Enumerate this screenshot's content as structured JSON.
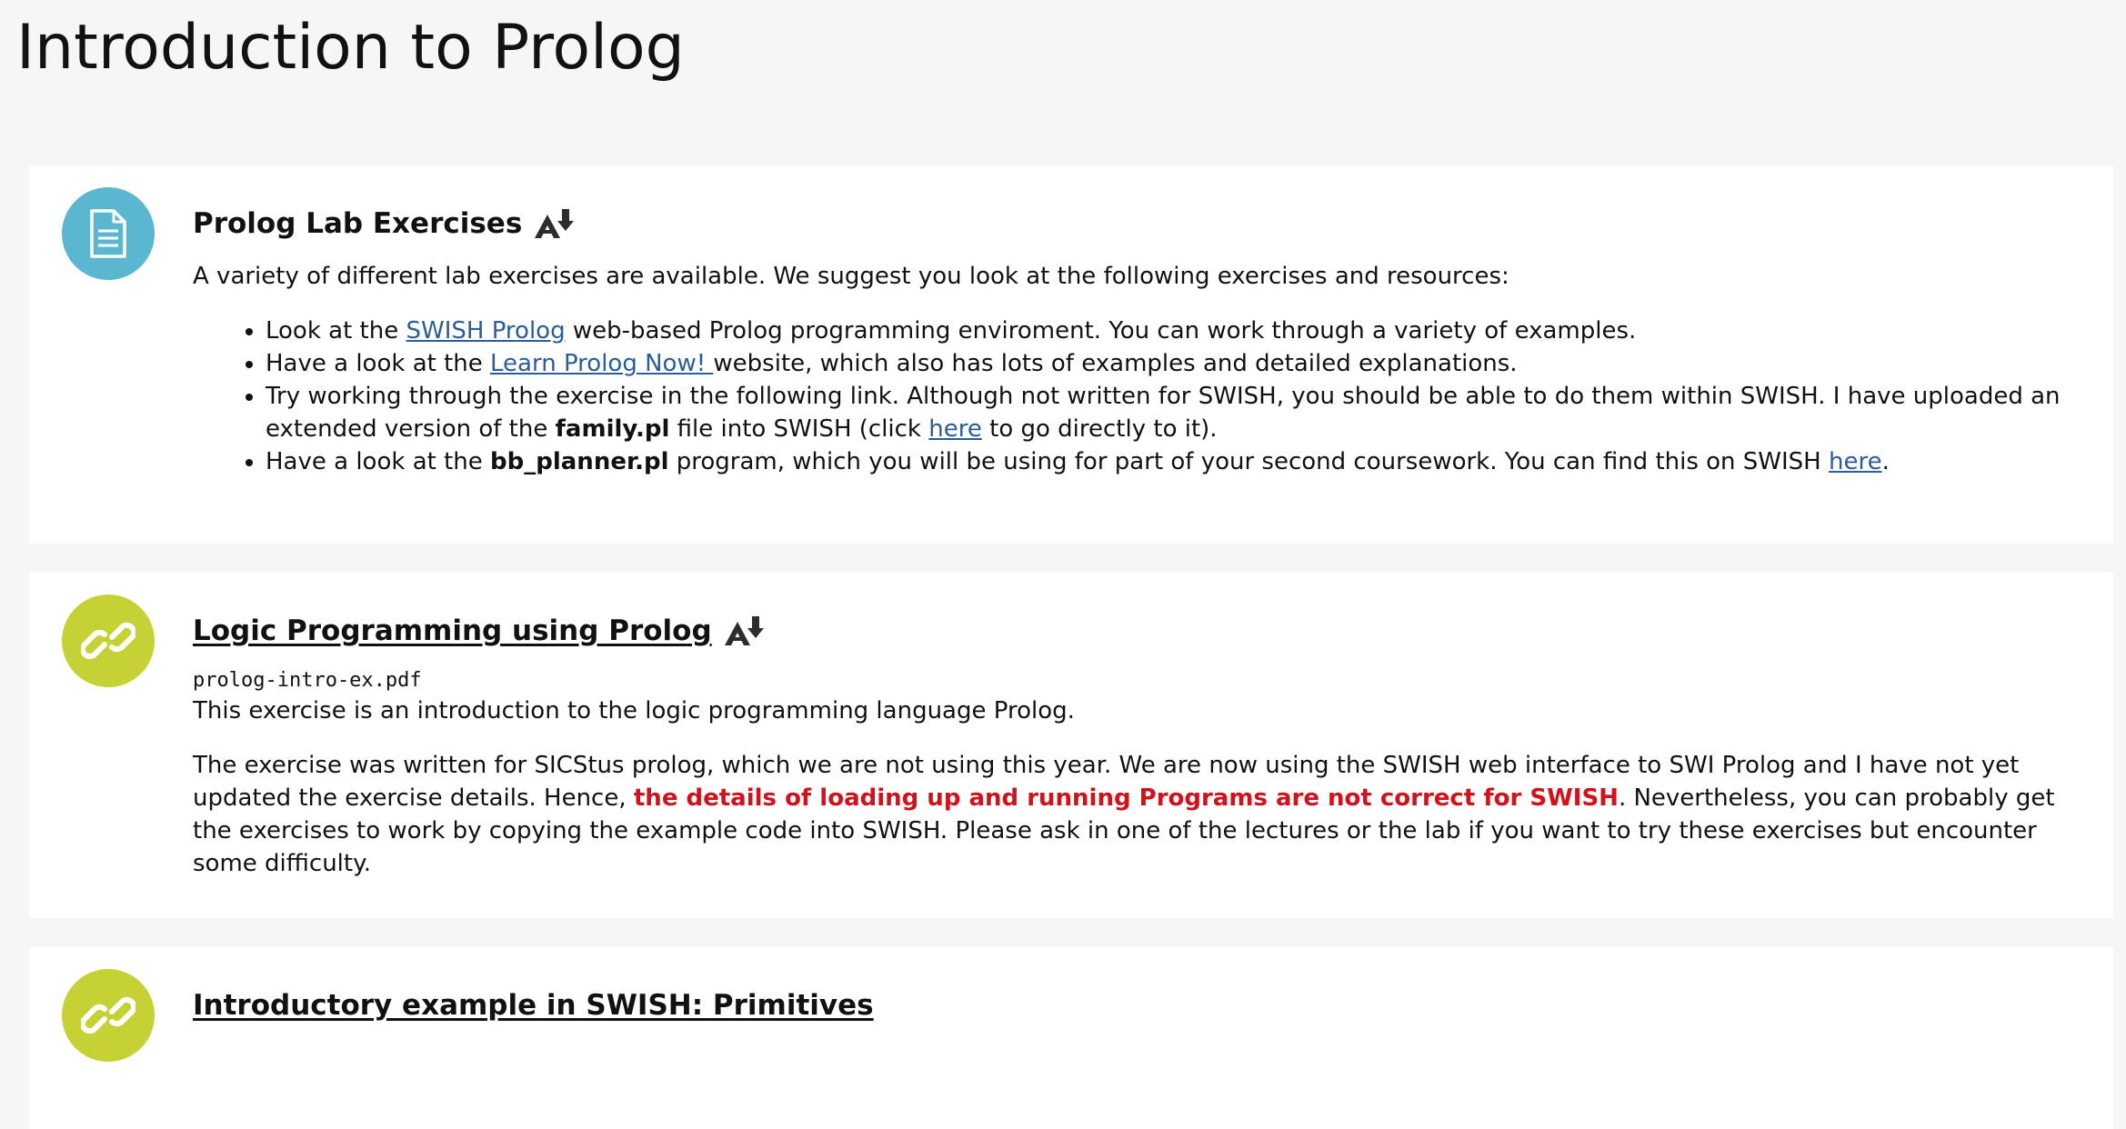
{
  "page": {
    "title": "Introduction to Prolog"
  },
  "activities": [
    {
      "icon": "document-icon",
      "icon_color": "#5bb7cf",
      "title": "Prolog Lab Exercises",
      "intro": "A variety of different lab exercises are available. We suggest you look at the following exercises and resources:",
      "items": [
        {
          "t1": "Look at the ",
          "link": "SWISH Prolog",
          "t2": " web-based Prolog programming enviroment. You can work through a variety of examples."
        },
        {
          "t1": "Have a look at the ",
          "link": "Learn Prolog Now! ",
          "t2": "website, which also has lots of examples and detailed explanations."
        },
        {
          "t1": "Try working through the exercise in the following link. Although not written for SWISH, you should be able to do them within SWISH. I have uploaded an extended version of the ",
          "bold": "family.pl",
          "t2": " file into SWISH (click ",
          "link": "here",
          "t3": " to go directly to it)."
        },
        {
          "t1": "Have a look at the ",
          "bold": "bb_planner.pl",
          "t2": " program, which you will be using for part of your second coursework. You can find this on SWISH ",
          "link": "here",
          "t3": "."
        }
      ]
    },
    {
      "icon": "link-icon",
      "icon_color": "#c5d134",
      "title": "Logic Programming using Prolog",
      "filename": "prolog-intro-ex.pdf",
      "p1": "This exercise is an introduction to the logic programming language Prolog.",
      "p2_a": "The exercise was written for SICStus prolog, which we are not using this year. We are now using the SWISH web interface to SWI Prolog and I have not yet updated the exercise details. Hence, ",
      "p2_warning": "the details of loading up and running Programs are not correct for SWISH",
      "p2_b": ". Nevertheless, you can probably get the exercises to work by copying the example code into SWISH. Please ask in one of the lectures or the lab if you want to try these exercises but encounter some difficulty."
    },
    {
      "icon": "link-icon",
      "icon_color": "#c5d134",
      "title": "Introductory example in SWISH: Primitives"
    }
  ],
  "colors": {
    "link": "#2b5e95",
    "warning": "#d1111b",
    "background": "#f6f6f6"
  }
}
